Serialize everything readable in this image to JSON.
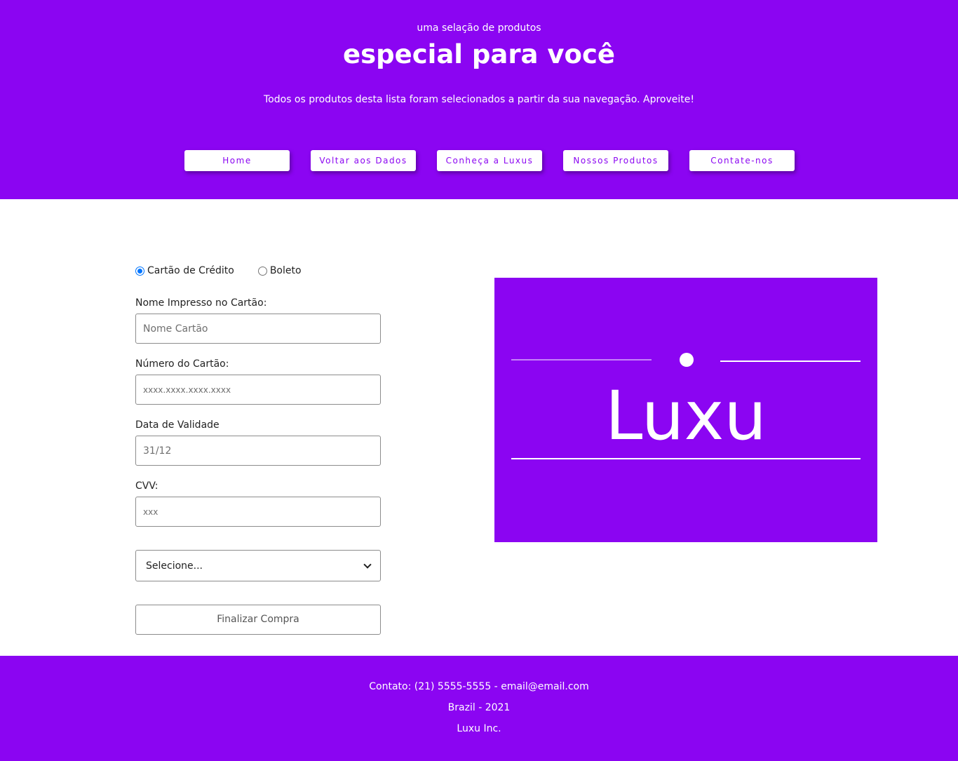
{
  "header": {
    "kicker": "uma selação de produtos",
    "headline": "especial para você",
    "subtitle": "Todos os produtos desta lista foram selecionados a partir da sua navegação. Aproveite!",
    "nav": [
      "Home",
      "Voltar aos Dados",
      "Conheça a Luxus",
      "Nossos Produtos",
      "Contate-nos"
    ]
  },
  "form": {
    "payment_options": [
      {
        "label": "Cartão de Crédito",
        "selected": true
      },
      {
        "label": "Boleto",
        "selected": false
      }
    ],
    "card_name": {
      "label": "Nome Impresso no Cartão:",
      "placeholder": "Nome Cartão"
    },
    "card_number": {
      "label": "Número do Cartão:",
      "placeholder": "xxxx.xxxx.xxxx.xxxx"
    },
    "expiry": {
      "label": "Data de Validade",
      "placeholder": "31/12"
    },
    "cvv": {
      "label": "CVV:",
      "placeholder": "xxx"
    },
    "select": {
      "value": "Selecione..."
    },
    "submit_label": "Finalizar Compra"
  },
  "logo": {
    "text": "Luxu"
  },
  "footer": {
    "contact": "Contato: (21) 5555-5555 - email@email.com",
    "location": "Brazil - 2021",
    "company": "Luxu Inc."
  },
  "colors": {
    "brand": "#8b05f2",
    "radio_accent": "#0075ff"
  }
}
